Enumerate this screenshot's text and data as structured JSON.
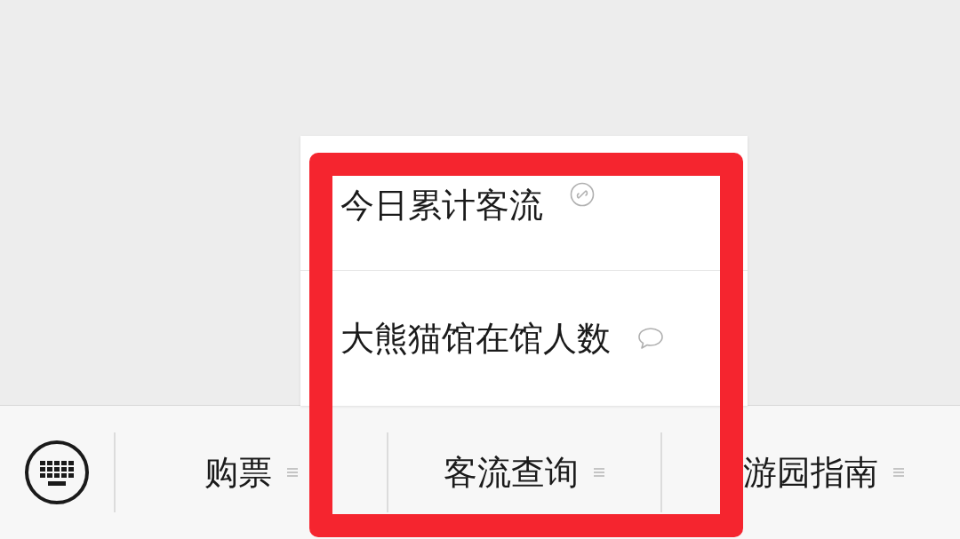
{
  "popup_menu": {
    "items": [
      {
        "label": "今日累计客流",
        "kind": "miniprogram"
      },
      {
        "label": "大熊猫馆在馆人数",
        "kind": "message"
      }
    ]
  },
  "bottom_menu": {
    "items": [
      {
        "label": "购票"
      },
      {
        "label": "客流查询"
      },
      {
        "label": "游园指南"
      }
    ]
  }
}
